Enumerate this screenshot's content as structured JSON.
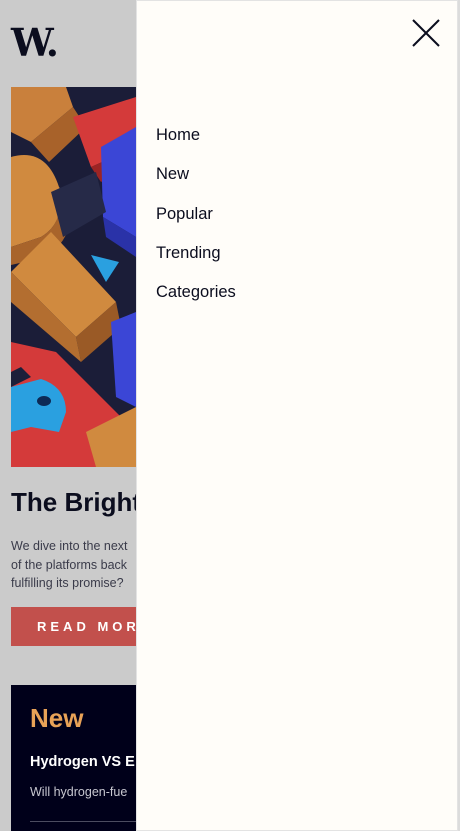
{
  "brand": {
    "logo_text": "W."
  },
  "article": {
    "headline": "The Bright",
    "excerpt_lines": [
      "We dive into the next",
      "of the platforms back",
      "fulfilling its promise?"
    ],
    "read_more_label": "READ MORE"
  },
  "new_section": {
    "title": "New",
    "item_title": "Hydrogen VS E",
    "item_description": "Will hydrogen-fue"
  },
  "menu": {
    "items": [
      {
        "label": "Home"
      },
      {
        "label": "New"
      },
      {
        "label": "Popular"
      },
      {
        "label": "Trending"
      },
      {
        "label": "Categories"
      }
    ]
  },
  "icons": {
    "close": "close-icon",
    "hero": "abstract-3d-blocks-image"
  },
  "colors": {
    "background_dim": "#cbcbcb",
    "dark_navy": "#0b0d1e",
    "accent_red": "#c2504c",
    "accent_orange": "#e8a257",
    "panel_bg": "#fffdf9"
  }
}
